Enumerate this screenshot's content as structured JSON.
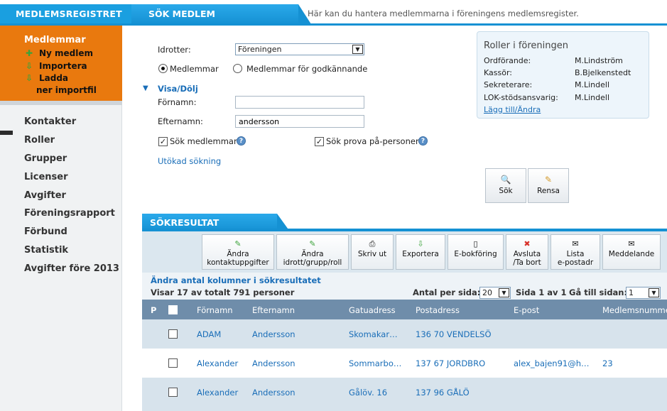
{
  "header": {
    "brand": "MEDLEMSREGISTRET",
    "tab": "SÖK MEDLEM",
    "tagline": "Här kan du hantera medlemmarna i föreningens medlemsregister."
  },
  "sidebar": {
    "active_section": "Medlemmar",
    "sub_items": [
      {
        "label": "Ny medlem",
        "icon": "plus-icon"
      },
      {
        "label": "Importera",
        "icon": "import-icon"
      },
      {
        "label": "Ladda",
        "icon": "download-icon"
      },
      {
        "label": "ner importfil",
        "icon": ""
      }
    ],
    "items": [
      "Kontakter",
      "Roller",
      "Grupper",
      "Licenser",
      "Avgifter",
      "Föreningsrapport",
      "Förbund",
      "Statistik",
      "Avgifter före 2013"
    ]
  },
  "search": {
    "idrotter_label": "Idrotter:",
    "idrotter_value": "Föreningen",
    "radio_members": "Medlemmar",
    "radio_approval": "Medlemmar för godkännande",
    "toggle_label": "Visa/Dölj",
    "fornamn_label": "Förnamn:",
    "fornamn_value": "",
    "efternamn_label": "Efternamn:",
    "efternamn_value": "andersson",
    "check_members": "Sök medlemmar",
    "check_trial": "Sök prova på-personer",
    "extended_search": "Utökad sökning",
    "search_button": "Sök",
    "clear_button": "Rensa"
  },
  "roles": {
    "title": "Roller i föreningen",
    "entries": [
      {
        "role": "Ordförande:",
        "name": "M.Lindström"
      },
      {
        "role": "Kassör:",
        "name": "B.Bjelkenstedt"
      },
      {
        "role": "Sekreterare:",
        "name": "M.Lindell"
      },
      {
        "role": "LOK-stödsansvarig:",
        "name": "M.Lindell"
      }
    ],
    "edit_link": "Lägg till/Ändra"
  },
  "results": {
    "title": "SÖKRESULTAT",
    "toolbar": [
      {
        "line1": "Ändra",
        "line2": "kontaktuppgifter",
        "icon": "pencil-icon"
      },
      {
        "line1": "Ändra",
        "line2": "idrott/grupp/roll",
        "icon": "pencil-icon"
      },
      {
        "line1": "Skriv ut",
        "line2": "",
        "icon": "print-icon"
      },
      {
        "line1": "Exportera",
        "line2": "",
        "icon": "export-icon"
      },
      {
        "line1": "E-bokföring",
        "line2": "",
        "icon": "book-icon"
      },
      {
        "line1": "Avsluta",
        "line2": "/Ta bort",
        "icon": "delete-icon"
      },
      {
        "line1": "Lista",
        "line2": "e-postadr",
        "icon": "mail-icon"
      },
      {
        "line1": "Meddelande",
        "line2": "",
        "icon": "message-icon"
      }
    ],
    "columns_link": "Ändra antal kolumner i sökresultatet",
    "count_text": "Visar 17 av totalt 791 personer",
    "per_page_label": "Antal per sida:",
    "per_page_value": "20",
    "page_text": "Sida 1 av 1",
    "goto_label": "Gå till sidan:",
    "goto_value": "1",
    "headers": [
      "P",
      "Förnamn",
      "Efternamn",
      "Gatuadress",
      "Postadress",
      "E-post",
      "Medlemsnumme"
    ],
    "rows": [
      {
        "fornamn": "ADAM",
        "efternamn": "Andersson",
        "gata": "Skomakar…",
        "post": "136 70 VENDELSÖ",
        "epost": "",
        "nr": ""
      },
      {
        "fornamn": "Alexander",
        "efternamn": "Andersson",
        "gata": "Sommarbo…",
        "post": "137 67 JORDBRO",
        "epost": "alex_bajen91@h…",
        "nr": "23"
      },
      {
        "fornamn": "Alexander",
        "efternamn": "Andersson",
        "gata": "Gålöv. 16",
        "post": "137 96 GÅLÖ",
        "epost": "",
        "nr": ""
      }
    ]
  }
}
